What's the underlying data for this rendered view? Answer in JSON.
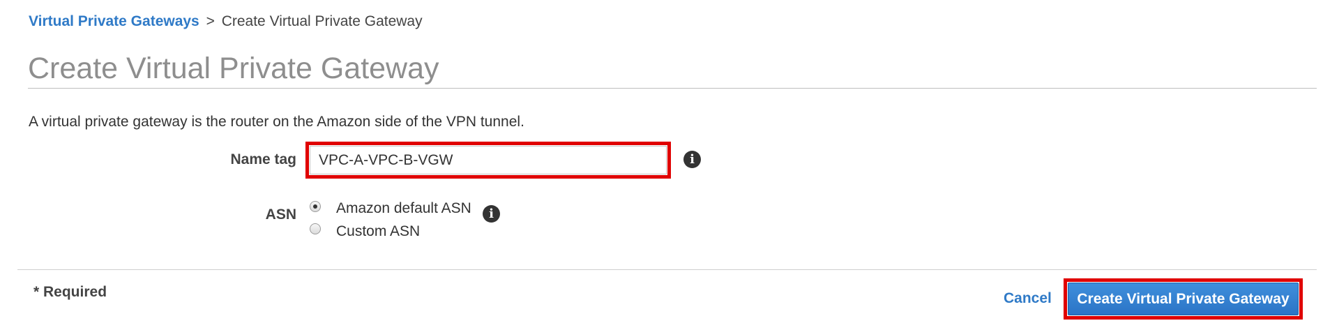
{
  "breadcrumb": {
    "parent_label": "Virtual Private Gateways",
    "separator": ">",
    "current_label": "Create Virtual Private Gateway"
  },
  "page": {
    "title": "Create Virtual Private Gateway",
    "description": "A virtual private gateway is the router on the Amazon side of the VPN tunnel."
  },
  "form": {
    "name_tag": {
      "label": "Name tag",
      "value": "VPC-A-VPC-B-VGW",
      "info_icon": "info-icon",
      "info_glyph": "i"
    },
    "asn": {
      "label": "ASN",
      "options": [
        {
          "label": "Amazon default ASN",
          "selected": true
        },
        {
          "label": "Custom ASN",
          "selected": false
        }
      ],
      "info_icon": "info-icon",
      "info_glyph": "i"
    }
  },
  "footer": {
    "required_note": "* Required",
    "cancel_label": "Cancel",
    "create_label": "Create Virtual Private Gateway"
  },
  "colors": {
    "link": "#2f7ac7",
    "primary_button": "#2b74c6",
    "highlight": "#e00000",
    "title": "#8e8e8e"
  }
}
